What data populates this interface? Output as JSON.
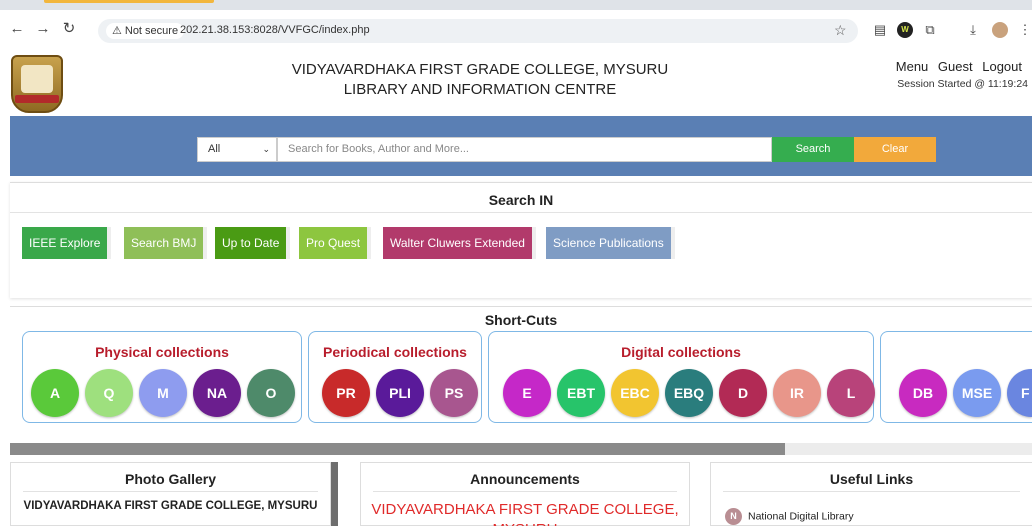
{
  "browser": {
    "security_label": "Not secure",
    "url": "202.21.38.153:8028/VVFGC/index.php"
  },
  "header": {
    "college_name": "VIDYAVARDHAKA FIRST GRADE COLLEGE, MYSURU",
    "subtitle": "LIBRARY AND INFORMATION CENTRE",
    "menu": [
      "Menu",
      "Guest",
      "Logout"
    ],
    "session": "Session Started @ 11:19:24"
  },
  "search": {
    "scope_selected": "All",
    "placeholder": "Search for Books, Author and More...",
    "search_label": "Search",
    "clear_label": "Clear"
  },
  "search_in": {
    "title": "Search IN",
    "buttons": [
      {
        "label": "IEEE Explore",
        "color": "#3aa84a"
      },
      {
        "label": "Search BMJ",
        "color": "#8fbf58"
      },
      {
        "label": "Up to Date",
        "color": "#4a9b14"
      },
      {
        "label": "Pro Quest",
        "color": "#8dc63f"
      },
      {
        "label": "Walter Cluwers Extended",
        "color": "#b23a6b"
      },
      {
        "label": "Science Publications",
        "color": "#7f9cc4"
      }
    ]
  },
  "shortcuts": {
    "title": "Short-Cuts",
    "groups": [
      {
        "title": "Physical collections",
        "items": [
          {
            "label": "A",
            "color": "#5ac93a"
          },
          {
            "label": "Q",
            "color": "#9ee07e"
          },
          {
            "label": "M",
            "color": "#8e9cef"
          },
          {
            "label": "NA",
            "color": "#6b1e8e"
          },
          {
            "label": "O",
            "color": "#4e8a6a"
          }
        ]
      },
      {
        "title": "Periodical collections",
        "items": [
          {
            "label": "PR",
            "color": "#c82a2a"
          },
          {
            "label": "PLI",
            "color": "#5a1a9a"
          },
          {
            "label": "PS",
            "color": "#a8568f"
          }
        ]
      },
      {
        "title": "Digital collections",
        "items": [
          {
            "label": "E",
            "color": "#c528c8"
          },
          {
            "label": "EBT",
            "color": "#27c46a"
          },
          {
            "label": "EBC",
            "color": "#f2c530"
          },
          {
            "label": "EBQ",
            "color": "#2a7d7d"
          },
          {
            "label": "D",
            "color": "#b22a55"
          },
          {
            "label": "IR",
            "color": "#e8968a"
          },
          {
            "label": "L",
            "color": "#b8437a"
          }
        ]
      },
      {
        "title": "",
        "items": [
          {
            "label": "DB",
            "color": "#c82ac0"
          },
          {
            "label": "MSE",
            "color": "#7a9bef"
          },
          {
            "label": "F",
            "color": "#6a86e0"
          }
        ]
      }
    ]
  },
  "cards": {
    "gallery_title": "Photo Gallery",
    "gallery_text": "VIDYAVARDHAKA FIRST GRADE COLLEGE, MYSURU",
    "announcements_title": "Announcements",
    "announcement_text": "VIDYAVARDHAKA FIRST GRADE COLLEGE, MYSURU",
    "links_title": "Useful Links",
    "link_badge": "N",
    "link_text": "National Digital Library"
  }
}
